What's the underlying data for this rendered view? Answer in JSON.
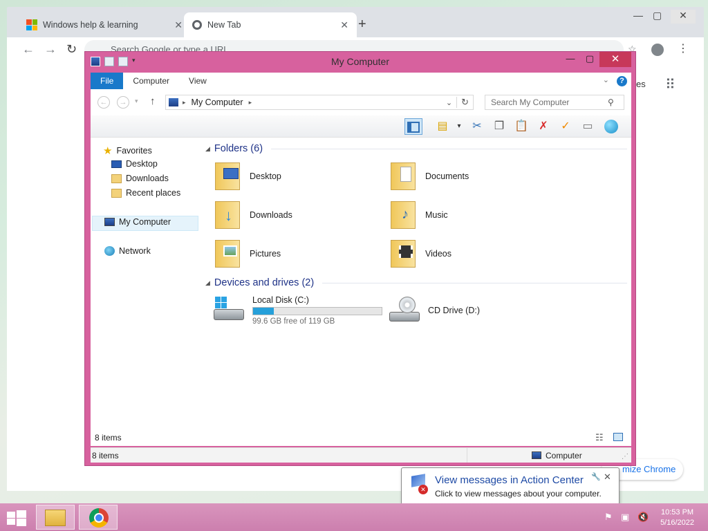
{
  "browser": {
    "tabs": [
      {
        "label": "Windows help & learning",
        "active": false
      },
      {
        "label": "New Tab",
        "active": true
      }
    ],
    "omnibox_placeholder": "Search Google or type a URL",
    "page_partial_label": "es",
    "customize_label": "mize Chrome"
  },
  "explorer": {
    "title": "My Computer",
    "ribbon_tabs": [
      "File",
      "Computer",
      "View"
    ],
    "address": {
      "crumb": "My Computer"
    },
    "search_placeholder": "Search My Computer",
    "nav": {
      "favorites": "Favorites",
      "desktop": "Desktop",
      "downloads": "Downloads",
      "recent": "Recent places",
      "computer": "My Computer",
      "network": "Network"
    },
    "folders_header": "Folders (6)",
    "folders": [
      {
        "name": "Desktop",
        "icon": "folder-desktop-icon"
      },
      {
        "name": "Documents",
        "icon": "folder-documents-icon"
      },
      {
        "name": "Downloads",
        "icon": "folder-downloads-icon"
      },
      {
        "name": "Music",
        "icon": "folder-music-icon"
      },
      {
        "name": "Pictures",
        "icon": "folder-pictures-icon"
      },
      {
        "name": "Videos",
        "icon": "folder-videos-icon"
      }
    ],
    "devices_header": "Devices and drives (2)",
    "drives": {
      "c_name": "Local Disk (C:)",
      "c_free": "99.6 GB free of 119 GB",
      "c_used_fraction": 0.163,
      "d_name": "CD Drive (D:)"
    },
    "items_count": "8 items",
    "status_count": "8 items",
    "status_location": "Computer"
  },
  "balloon": {
    "title": "View messages in Action Center",
    "body": "Click to view messages about your computer."
  },
  "taskbar": {
    "time": "10:53 PM",
    "date": "5/16/2022"
  },
  "colors": {
    "window_frame": "#d7619e",
    "accent_blue": "#1979ca",
    "close_button": "#c7385a",
    "taskbar": "#cc7fae",
    "drive_bar": "#26a0da"
  }
}
